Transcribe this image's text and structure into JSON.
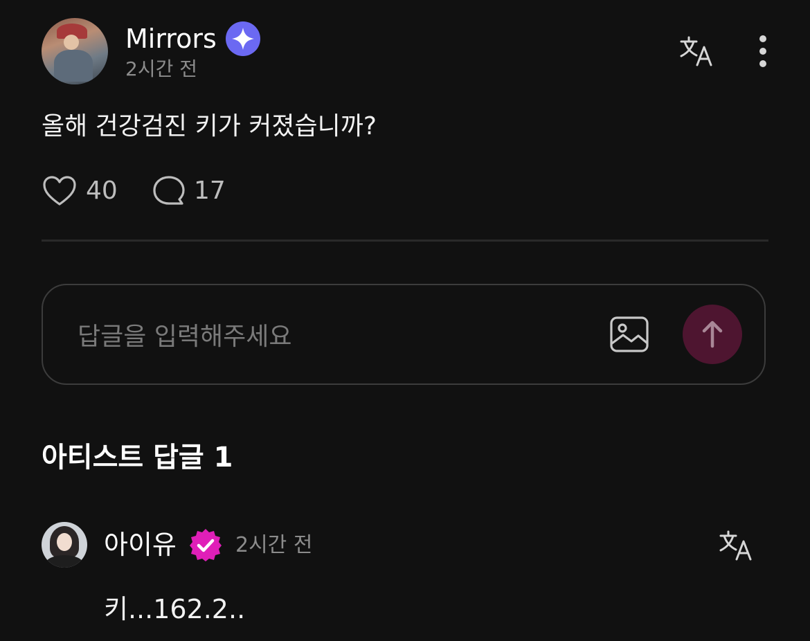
{
  "post": {
    "author": "Mirrors",
    "time": "2시간 전",
    "body": "올해 건강검진 키가 커졌습니까?",
    "likes": "40",
    "comments": "17",
    "icons": {
      "verified": "sparkle-badge-icon",
      "translate": "translate-icon",
      "more": "more-vertical-icon",
      "like": "heart-icon",
      "comment": "comment-bubble-icon"
    }
  },
  "reply_box": {
    "placeholder": "답글을 입력해주세요",
    "value": "",
    "icons": {
      "image": "image-icon",
      "send": "arrow-up-icon"
    }
  },
  "section": {
    "title": "아티스트 답글 1"
  },
  "artist_reply": {
    "name": "아이유",
    "time": "2시간 전",
    "text": "키...162.2..",
    "icons": {
      "verified": "verified-check-badge-icon",
      "translate": "translate-icon"
    }
  },
  "colors": {
    "background": "#111111",
    "verified_blue": "#6b69f2",
    "verified_pink": "#e01fb8",
    "send_button": "#4e1530",
    "muted_text": "#8c8c8c"
  }
}
